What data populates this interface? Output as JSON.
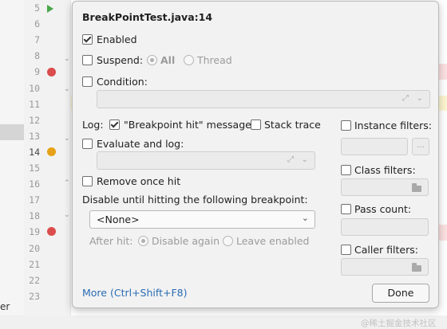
{
  "editor": {
    "line_numbers": [
      "5",
      "6",
      "7",
      "8",
      "9",
      "10",
      "11",
      "12",
      "13",
      "14",
      "15",
      "16",
      "17",
      "18",
      "19",
      "20",
      "21",
      "22",
      "23"
    ],
    "current_line": "14",
    "project_panel_text": "er"
  },
  "popup": {
    "title": "BreakPointTest.java:14",
    "enabled": {
      "label": "Enabled",
      "checked": true
    },
    "suspend": {
      "label": "Suspend:",
      "checked": false,
      "options": [
        "All",
        "Thread"
      ],
      "selected": "All"
    },
    "condition": {
      "label": "Condition:",
      "checked": false,
      "value": ""
    },
    "log": {
      "label": "Log:",
      "breakpoint_hit": {
        "label": "\"Breakpoint hit\" message",
        "checked": true
      },
      "stack_trace": {
        "label": "Stack trace",
        "checked": false
      }
    },
    "evaluate_and_log": {
      "label": "Evaluate and log:",
      "checked": false,
      "value": ""
    },
    "remove_once_hit": {
      "label": "Remove once hit",
      "checked": false
    },
    "disable_until": {
      "label": "Disable until hitting the following breakpoint:",
      "value": "<None>"
    },
    "after_hit": {
      "label": "After hit:",
      "options": [
        "Disable again",
        "Leave enabled"
      ],
      "selected": "Disable again"
    },
    "instance_filters": {
      "label": "Instance filters:",
      "checked": false,
      "button": "..."
    },
    "class_filters": {
      "label": "Class filters:",
      "checked": false
    },
    "pass_count": {
      "label": "Pass count:",
      "checked": false
    },
    "caller_filters": {
      "label": "Caller filters:",
      "checked": false
    },
    "more_link": "More (Ctrl+Shift+F8)",
    "done": "Done"
  },
  "watermark": "@稀土掘金技术社区",
  "colors": {
    "accent_link": "#2a6cb3",
    "breakpoint_red": "#db4c4c",
    "breakpoint_orange": "#e6a117",
    "line_highlight": "#fcf5cf"
  }
}
